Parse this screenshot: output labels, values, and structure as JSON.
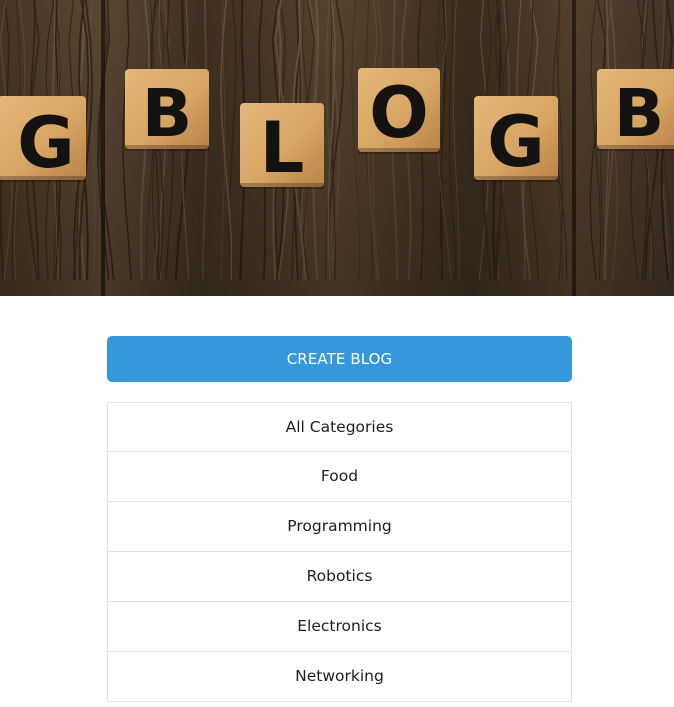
{
  "hero": {
    "letters": [
      "G",
      "B",
      "L",
      "O",
      "G",
      "B"
    ]
  },
  "actions": {
    "create_blog_label": "CREATE BLOG"
  },
  "categories": [
    {
      "label": "All Categories"
    },
    {
      "label": "Food"
    },
    {
      "label": "Programming"
    },
    {
      "label": "Robotics"
    },
    {
      "label": "Electronics"
    },
    {
      "label": "Networking"
    }
  ],
  "colors": {
    "accent": "#3498db",
    "wood_dark": "#3f2f22",
    "tile": "#d9a968"
  }
}
